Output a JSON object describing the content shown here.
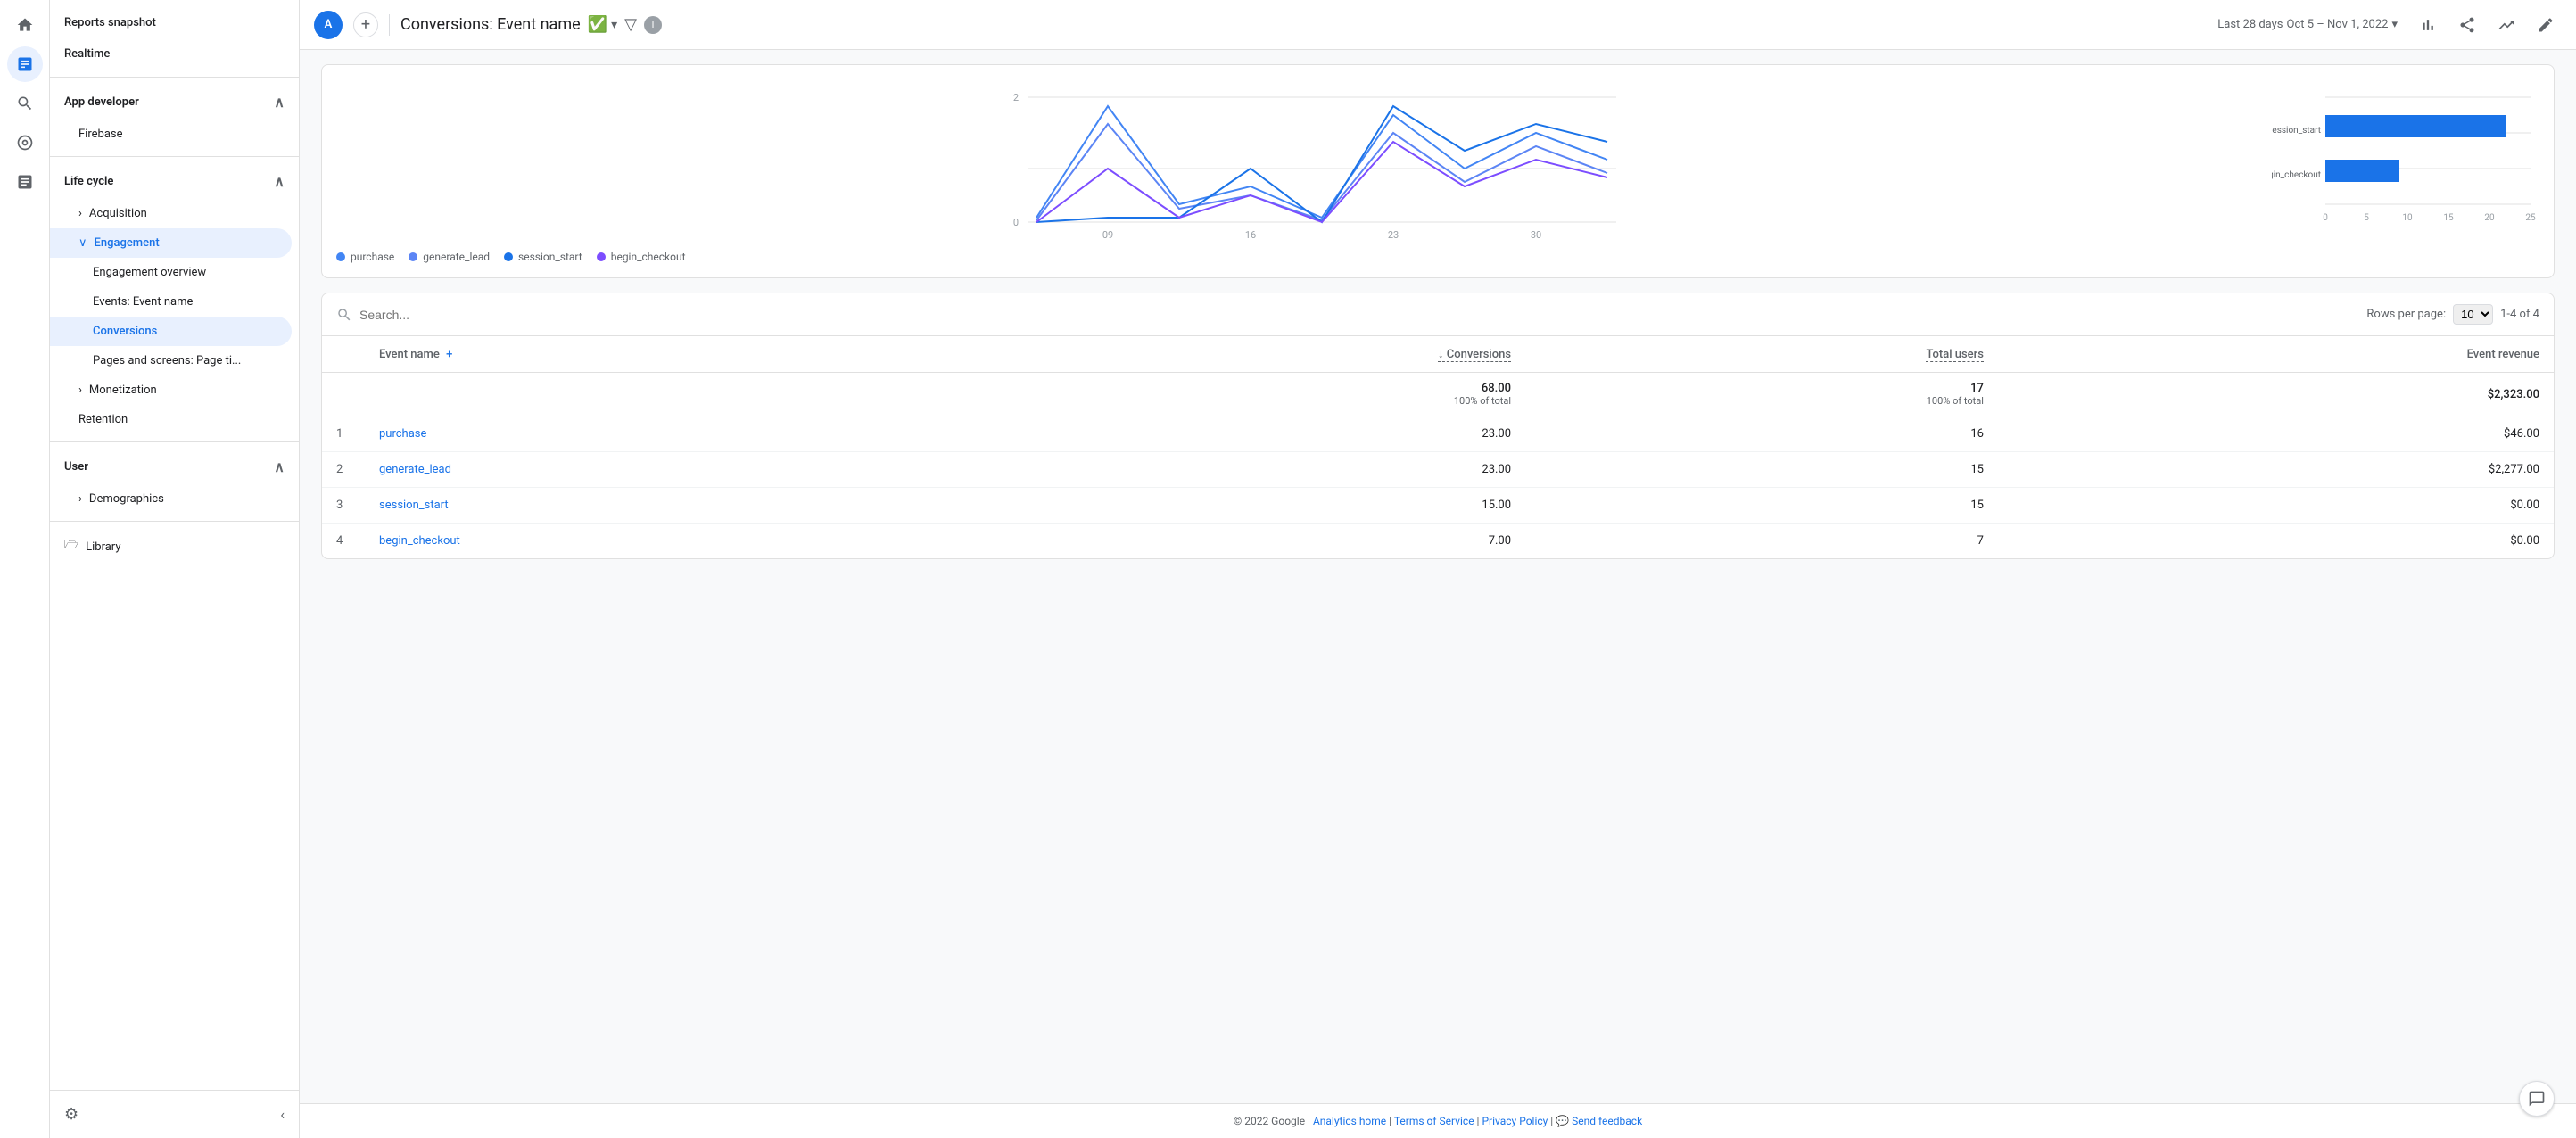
{
  "sidebar_icons": {
    "home_icon": "⌂",
    "analytics_icon": "📊",
    "search_icon": "🔍",
    "target_icon": "◎",
    "reports_icon": "≡"
  },
  "nav": {
    "reports_snapshot": "Reports snapshot",
    "realtime": "Realtime",
    "app_developer": "App developer",
    "firebase": "Firebase",
    "life_cycle": "Life cycle",
    "acquisition": "Acquisition",
    "engagement": "Engagement",
    "engagement_overview": "Engagement overview",
    "events_event_name": "Events: Event name",
    "conversions": "Conversions",
    "pages_and_screens": "Pages and screens: Page ti...",
    "monetization": "Monetization",
    "retention": "Retention",
    "user": "User",
    "demographics": "Demographics",
    "library": "Library",
    "settings_icon": "⚙",
    "collapse_icon": "‹"
  },
  "topbar": {
    "avatar_label": "A",
    "add_label": "+",
    "page_title": "Conversions: Event name",
    "date_label": "Last 28 days",
    "date_range": "Oct 5 – Nov 1, 2022",
    "filter_label": "▼"
  },
  "chart": {
    "x_labels": [
      "09\nOct",
      "16",
      "23",
      "30"
    ],
    "y_labels": [
      "0",
      "2"
    ],
    "bar_y_labels": [
      "0",
      "5",
      "10",
      "15",
      "20",
      "25"
    ],
    "bar_items": [
      {
        "label": "session_start",
        "value": 22,
        "max": 25
      },
      {
        "label": "begin_checkout",
        "value": 9,
        "max": 25
      }
    ],
    "legend": [
      {
        "label": "purchase",
        "color": "#4285f4"
      },
      {
        "label": "generate_lead",
        "color": "#5c85f5"
      },
      {
        "label": "session_start",
        "color": "#1a73e8"
      },
      {
        "label": "begin_checkout",
        "color": "#7c4dff"
      }
    ]
  },
  "table": {
    "search_placeholder": "Search...",
    "rows_per_page_label": "Rows per page:",
    "rows_per_page_value": "10",
    "pagination": "1-4 of 4",
    "columns": [
      "",
      "Event name",
      "↓ Conversions",
      "Total users",
      "Event revenue"
    ],
    "totals": {
      "conversions": "68.00",
      "conversions_sub": "100% of total",
      "users": "17",
      "users_sub": "100% of total",
      "revenue": "$2,323.00"
    },
    "rows": [
      {
        "rank": "1",
        "name": "purchase",
        "conversions": "23.00",
        "users": "16",
        "revenue": "$46.00"
      },
      {
        "rank": "2",
        "name": "generate_lead",
        "conversions": "23.00",
        "users": "15",
        "revenue": "$2,277.00"
      },
      {
        "rank": "3",
        "name": "session_start",
        "conversions": "15.00",
        "users": "15",
        "revenue": "$0.00"
      },
      {
        "rank": "4",
        "name": "begin_checkout",
        "conversions": "7.00",
        "users": "7",
        "revenue": "$0.00"
      }
    ]
  },
  "footer": {
    "copyright": "© 2022 Google",
    "analytics_home": "Analytics home",
    "terms": "Terms of Service",
    "privacy": "Privacy Policy",
    "feedback": "Send feedback"
  }
}
